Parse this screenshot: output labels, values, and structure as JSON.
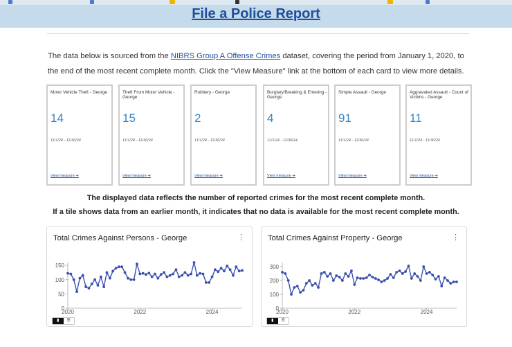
{
  "header": {
    "title": "File a Police Report"
  },
  "intro": {
    "text_before": "The data below is sourced from the ",
    "link_text": "NIBRS Group A Offense Crimes",
    "text_after": " dataset, covering the period from January 1, 2020, to the end of the most recent complete month. Click the \"View Measure\" link at the bottom of each card to view more details."
  },
  "kpis": [
    {
      "title": "Motor Vehicle Theft - George",
      "value": "14",
      "date": "11/1/24 - 11/30/24",
      "link": "View measure ➔"
    },
    {
      "title": "Theft From Motor Vehicle - George",
      "value": "15",
      "date": "11/1/24 - 11/30/24",
      "link": "View measure ➔"
    },
    {
      "title": "Robbery - George",
      "value": "2",
      "date": "11/1/24 - 11/30/24",
      "link": "View measure ➔"
    },
    {
      "title": "Burglary/Breaking & Entering - George",
      "value": "4",
      "date": "11/1/24 - 11/30/24",
      "link": "View measure ➔"
    },
    {
      "title": "Simple Assault - George",
      "value": "91",
      "date": "11/1/24 - 11/30/24",
      "link": "View measure ➔"
    },
    {
      "title": "Aggravated Assault - Count of Victims - George",
      "value": "11",
      "date": "11/1/24 - 11/30/24",
      "link": "View measure ➔"
    }
  ],
  "notes": {
    "line1": "The displayed data reflects the number of reported crimes for the most recent complete month.",
    "line2": "If a tile shows data from an earlier month, it indicates that no data is available for the most recent complete month."
  },
  "cards": {
    "persons": {
      "title": "Total Crimes Against Persons - George",
      "menu_icon": "kebab-menu-icon"
    },
    "property": {
      "title": "Total Crimes Against Property - George",
      "menu_icon": "kebab-menu-icon"
    }
  },
  "toggle": {
    "chart_icon": "bar-chart-icon",
    "table_icon": "table-icon"
  },
  "colors": {
    "line": "#3a4fb0",
    "value": "#3a86c4",
    "link": "#1f4f9c",
    "banner": "#c5daea"
  },
  "chart_data": [
    {
      "type": "line",
      "title": "Total Crimes Against Persons - George",
      "x_tick_labels": [
        "2020",
        "2022",
        "2024"
      ],
      "y_ticks": [
        0,
        50,
        100,
        150
      ],
      "ylim": [
        0,
        160
      ],
      "x": [
        "2020-01",
        "2020-02",
        "2020-03",
        "2020-04",
        "2020-05",
        "2020-06",
        "2020-07",
        "2020-08",
        "2020-09",
        "2020-10",
        "2020-11",
        "2020-12",
        "2021-01",
        "2021-02",
        "2021-03",
        "2021-04",
        "2021-05",
        "2021-06",
        "2021-07",
        "2021-08",
        "2021-09",
        "2021-10",
        "2021-11",
        "2021-12",
        "2022-01",
        "2022-02",
        "2022-03",
        "2022-04",
        "2022-05",
        "2022-06",
        "2022-07",
        "2022-08",
        "2022-09",
        "2022-10",
        "2022-11",
        "2022-12",
        "2023-01",
        "2023-02",
        "2023-03",
        "2023-04",
        "2023-05",
        "2023-06",
        "2023-07",
        "2023-08",
        "2023-09",
        "2023-10",
        "2023-11",
        "2023-12",
        "2024-01",
        "2024-02",
        "2024-03",
        "2024-04",
        "2024-05",
        "2024-06",
        "2024-07",
        "2024-08",
        "2024-09",
        "2024-10",
        "2024-11"
      ],
      "series": [
        {
          "values": [
            122,
            120,
            100,
            58,
            105,
            115,
            75,
            70,
            85,
            100,
            80,
            110,
            75,
            125,
            105,
            130,
            140,
            145,
            145,
            125,
            105,
            100,
            100,
            155,
            120,
            122,
            118,
            123,
            110,
            120,
            105,
            118,
            125,
            110,
            115,
            120,
            135,
            110,
            115,
            125,
            115,
            120,
            160,
            115,
            122,
            120,
            90,
            90,
            110,
            135,
            128,
            140,
            130,
            148,
            135,
            115,
            145,
            130,
            132
          ]
        }
      ]
    },
    {
      "type": "line",
      "title": "Total Crimes Against Property - George",
      "x_tick_labels": [
        "2020",
        "2022",
        "2024"
      ],
      "y_ticks": [
        0,
        100,
        200,
        300
      ],
      "ylim": [
        0,
        330
      ],
      "x": [
        "2020-01",
        "2020-02",
        "2020-03",
        "2020-04",
        "2020-05",
        "2020-06",
        "2020-07",
        "2020-08",
        "2020-09",
        "2020-10",
        "2020-11",
        "2020-12",
        "2021-01",
        "2021-02",
        "2021-03",
        "2021-04",
        "2021-05",
        "2021-06",
        "2021-07",
        "2021-08",
        "2021-09",
        "2021-10",
        "2021-11",
        "2021-12",
        "2022-01",
        "2022-02",
        "2022-03",
        "2022-04",
        "2022-05",
        "2022-06",
        "2022-07",
        "2022-08",
        "2022-09",
        "2022-10",
        "2022-11",
        "2022-12",
        "2023-01",
        "2023-02",
        "2023-03",
        "2023-04",
        "2023-05",
        "2023-06",
        "2023-07",
        "2023-08",
        "2023-09",
        "2023-10",
        "2023-11",
        "2023-12",
        "2024-01",
        "2024-02",
        "2024-03",
        "2024-04",
        "2024-05",
        "2024-06",
        "2024-07",
        "2024-08",
        "2024-09",
        "2024-10",
        "2024-11"
      ],
      "series": [
        {
          "values": [
            260,
            250,
            200,
            100,
            150,
            160,
            115,
            130,
            180,
            200,
            165,
            180,
            150,
            250,
            260,
            230,
            250,
            200,
            235,
            225,
            200,
            250,
            230,
            270,
            170,
            220,
            215,
            215,
            220,
            240,
            225,
            215,
            205,
            190,
            200,
            215,
            245,
            220,
            260,
            270,
            250,
            265,
            305,
            215,
            250,
            230,
            200,
            300,
            250,
            260,
            240,
            210,
            230,
            160,
            220,
            200,
            180,
            190,
            190
          ]
        }
      ]
    }
  ]
}
